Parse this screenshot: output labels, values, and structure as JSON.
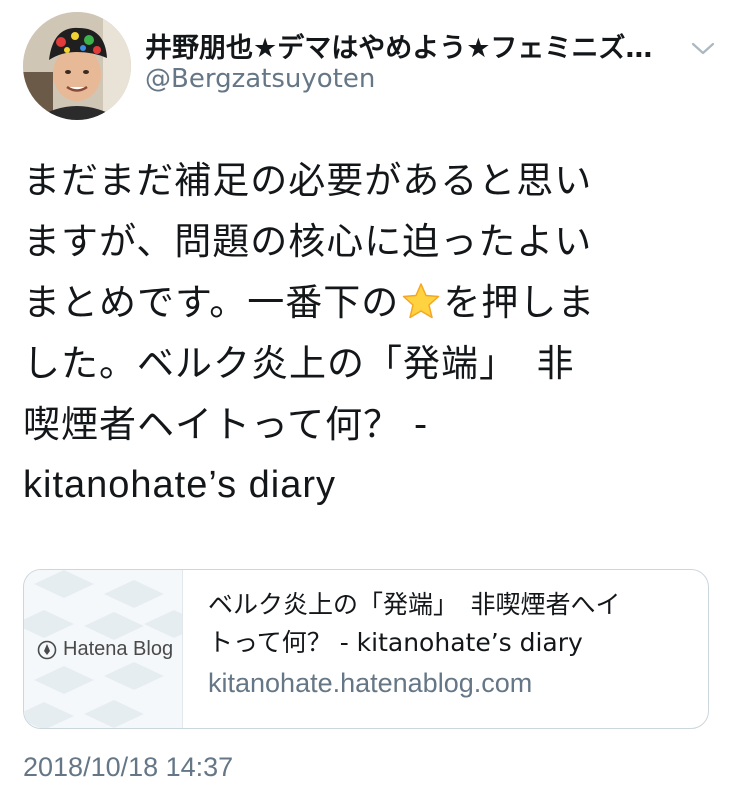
{
  "author": {
    "display_name": "井野朋也★デマはやめよう★フェミニズ…",
    "handle": "@Bergzatsuyoten"
  },
  "tweet": {
    "lines": [
      "まだまだ補足の必要があると思い",
      "ますが、問題の核心に迫ったよい",
      "まとめです。一番下の",
      "を押しま",
      "した。ベルク炎上の「発端」　非",
      "喫煙者ヘイトって何？ -",
      "kitanohate’s diary"
    ],
    "emoji": "star-emoji"
  },
  "card": {
    "title_line1": "ベルク炎上の「発端」　非喫煙者へイ",
    "title_line2": "トって何？ - kitanohate’s diary",
    "url": "kitanohate.hatenablog.com",
    "thumbnail_logo": "Hatena Blog"
  },
  "timestamp": "2018/10/18 14:37",
  "colors": {
    "text": "#14171a",
    "secondary": "#657786",
    "border": "#ccd6dd",
    "star": "#ffcc33"
  }
}
